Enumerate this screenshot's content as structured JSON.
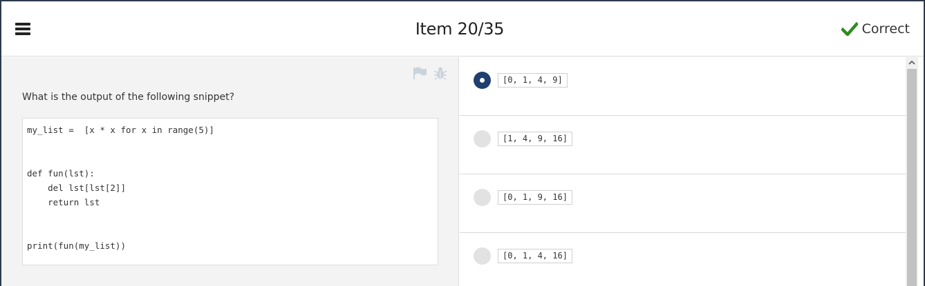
{
  "header": {
    "title": "Item 20/35",
    "status_label": "Correct",
    "status_color": "#2e8b1e",
    "menu_icon": "hamburger-icon",
    "status_icon": "checkmark-icon"
  },
  "question": {
    "prompt": "What is the output of the following snippet?",
    "code": "my_list =  [x * x for x in range(5)]\n\n\ndef fun(lst):\n    del lst[lst[2]]\n    return lst\n\n\nprint(fun(my_list))",
    "tools": [
      "flag-icon",
      "bug-icon"
    ]
  },
  "options": [
    {
      "text": "[0, 1, 4, 9]",
      "selected": true
    },
    {
      "text": "[1, 4, 9, 16]",
      "selected": false
    },
    {
      "text": "[0, 1, 9, 16]",
      "selected": false
    },
    {
      "text": "[0, 1, 4, 16]",
      "selected": false
    }
  ],
  "colors": {
    "accent": "#1f3f6e",
    "frame": "#2b3a4a"
  }
}
